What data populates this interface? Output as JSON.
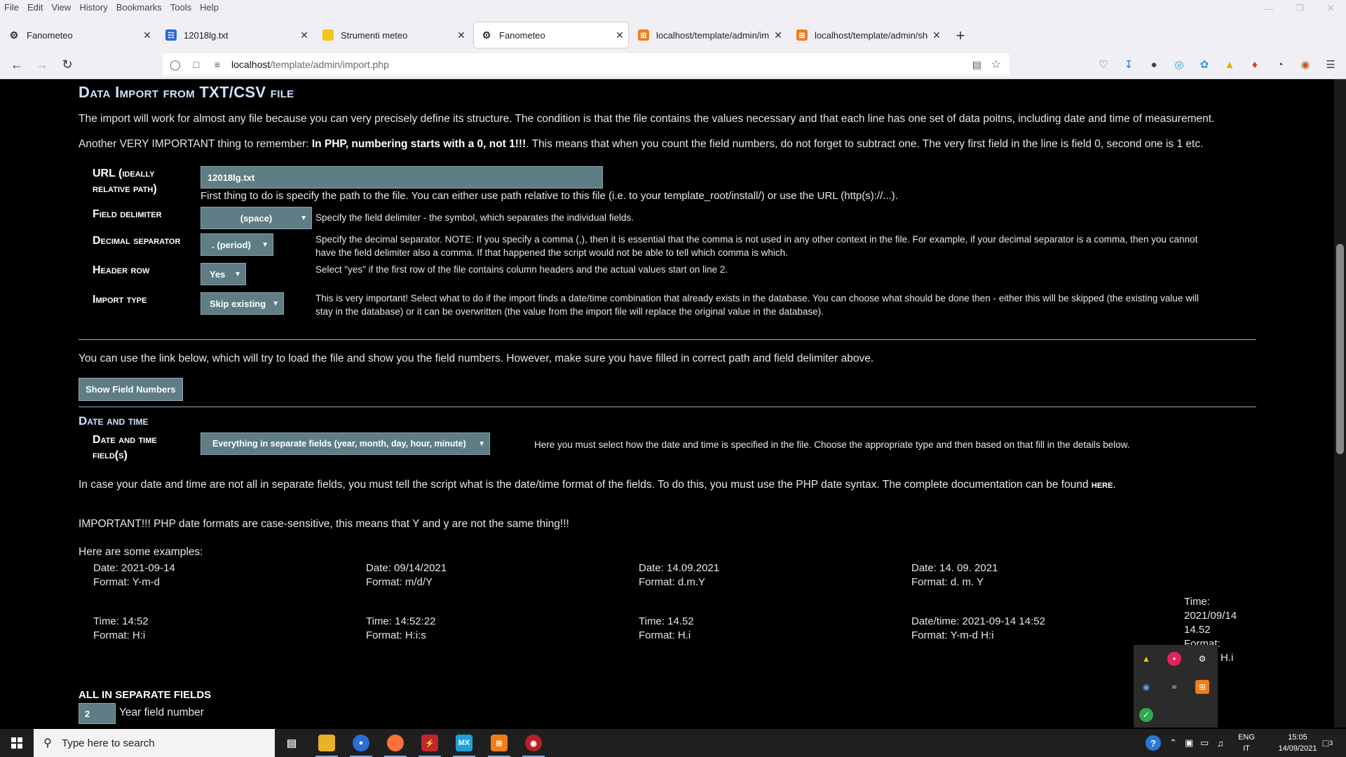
{
  "menubar": [
    "File",
    "Edit",
    "View",
    "History",
    "Bookmarks",
    "Tools",
    "Help"
  ],
  "tabs": [
    {
      "title": "Fanometeo",
      "icon": "fanometeo-icon",
      "active": false
    },
    {
      "title": "12018lg.txt",
      "icon": "file-icon",
      "active": false
    },
    {
      "title": "Strumenti meteo",
      "icon": "folder-icon",
      "active": false
    },
    {
      "title": "Fanometeo",
      "icon": "fanometeo-icon",
      "active": true
    },
    {
      "title": "localhost/template/admin/imp",
      "icon": "xampp-icon",
      "active": false
    },
    {
      "title": "localhost/template/admin/sho",
      "icon": "xampp-icon",
      "active": false
    }
  ],
  "url": {
    "host": "localhost",
    "path": "/template/admin/import.php"
  },
  "page": {
    "title": "Data Import from TXT/CSV file",
    "intro1": "The import will work for almost any file because you can very precisely define its structure. The condition is that the file contains the values necessary and that each line has one set of data poitns, including date and time of measurement.",
    "intro2_a": "Another VERY IMPORTANT thing to remember: ",
    "intro2_b": "In PHP, numbering starts with a 0, not 1!!!",
    "intro2_c": ". This means that when you count the field numbers, do not forget to subtract one. The very first field in the line is field 0, second one is 1 etc.",
    "url_label_1": "URL (ideally",
    "url_label_2": "relative path)",
    "url_value": "12018lg.txt",
    "url_desc": "First thing to do is specify the path to the file. You can either use path relative to this file (i.e. to your template_root/install/) or use the URL (http(s)://...).",
    "delim_label": "Field delimiter",
    "delim_value": "(space)",
    "delim_desc": "Specify the field delimiter - the symbol, which separates the individual fields.",
    "dec_label": "Decimal separator",
    "dec_value": ". (period)",
    "dec_desc_1": "Specify the decimal separator. NOTE: If you specify a comma (,), then it is essential that the comma is not used in any other context in the file. For example, if your decimal separator is a comma, then you cannot",
    "dec_desc_2": "have the field delimiter also a comma. If that happened the script would not be able to tell which comma is which.",
    "header_label": "Header row",
    "header_value": "Yes",
    "header_desc": "Select \"yes\" if the first row of the file contains column headers and the actual values start on line 2.",
    "import_label": "Import type",
    "import_value": "Skip existing",
    "import_desc_1": "This is very important! Select what to do if the import finds a date/time combination that already exists in the database. You can choose what should be done then - either this will be skipped (the existing value will",
    "import_desc_2": "stay in the database) or it can be overwritten (the value from the import file will replace the original value in the database).",
    "link_text": "You can use the link below, which will try to load the file and show you the field numbers. However, make sure you have filled in correct path and field delimiter above.",
    "show_btn": "Show Field Numbers",
    "dt_heading": "Date and time",
    "dt_label_1": "Date and time",
    "dt_label_2": "field(s)",
    "dt_value": "Everything in separate fields (year, month, day, hour, minute)",
    "dt_desc": "Here you must select how the date and time is specified in the file. Choose the appropriate type and then based on that fill in the details below.",
    "format_text": "In case your date and time are not all in separate fields, you must tell the script what is the date/time format of the fields. To do this, you must use the PHP date syntax. The complete documentation can be found ",
    "format_link": "here",
    "format_end": ".",
    "important": "IMPORTANT!!! PHP date formats are case-sensitive, this means that Y and y are not the same thing!!!",
    "examples_title": "Here are some examples:",
    "examples": [
      {
        "a": "Date: 2021-09-14",
        "b": "Format: Y-m-d"
      },
      {
        "a": "Date: 09/14/2021",
        "b": "Format: m/d/Y"
      },
      {
        "a": "Date: 14.09.2021",
        "b": "Format: d.m.Y"
      },
      {
        "a": "Date: 14. 09. 2021",
        "b": "Format: d. m. Y"
      },
      {
        "a": "Time: 14:52",
        "b": "Format: H:i"
      },
      {
        "a": "Time: 14:52:22",
        "b": "Format: H:i:s"
      },
      {
        "a": "Time: 14.52",
        "b": "Format: H.i"
      },
      {
        "a": "Date/time: 2021-09-14 14:52",
        "b": "Format: Y-m-d H:i"
      }
    ],
    "example_last": [
      "Time:",
      "2021/09/14",
      "14.52",
      "Format:",
      "H.i"
    ],
    "separate_heading": "ALL IN SEPARATE FIELDS",
    "year_value": "2",
    "year_label": "Year field number"
  },
  "taskbar": {
    "search_placeholder": "Type here to search",
    "lang_1": "ENG",
    "lang_2": "IT",
    "time": "15:05",
    "date": "14/09/2021",
    "notif_count": "3"
  }
}
